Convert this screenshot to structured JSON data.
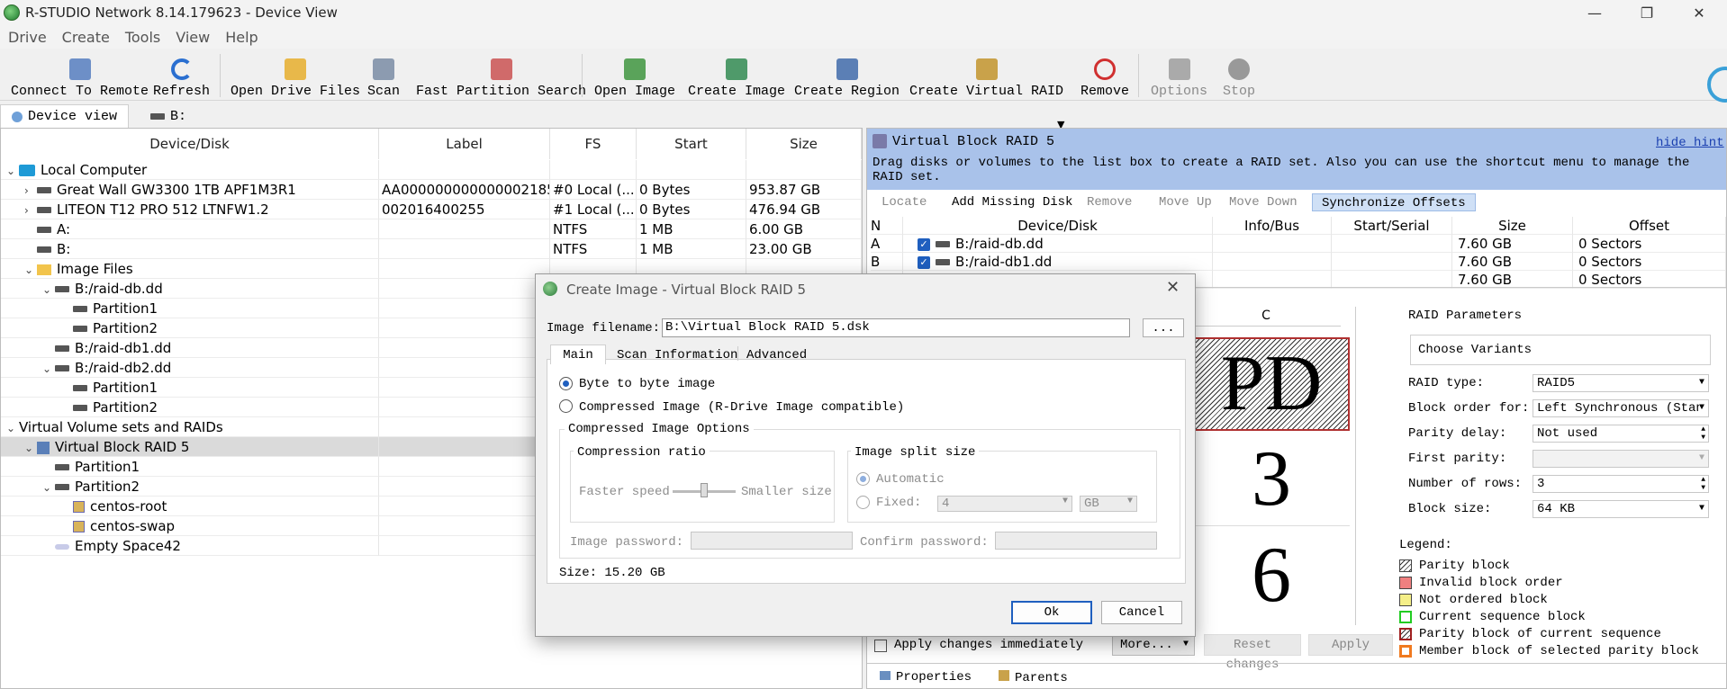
{
  "window": {
    "title": "R-STUDIO Network 8.14.179623 - Device View"
  },
  "menu": [
    "Drive",
    "Create",
    "Tools",
    "View",
    "Help"
  ],
  "toolbar": {
    "connect": "Connect To Remote",
    "refresh": "Refresh",
    "open_drive": "Open Drive Files",
    "scan": "Scan",
    "fast_search": "Fast Partition Search",
    "open_image": "Open Image",
    "create_image": "Create Image",
    "create_region": "Create Region",
    "create_vraid": "Create Virtual RAID",
    "remove": "Remove",
    "options": "Options",
    "stop": "Stop"
  },
  "tabs": {
    "device_view": "Device view",
    "b": "B:"
  },
  "tree": {
    "headers": {
      "device": "Device/Disk",
      "label": "Label",
      "fs": "FS",
      "start": "Start",
      "size": "Size"
    },
    "rows": [
      {
        "name": "Local Computer",
        "label": "",
        "fs": "",
        "start": "",
        "size": ""
      },
      {
        "name": "Great Wall GW3300 1TB APF1M3R1",
        "label": "AA000000000000002185",
        "fs": "#0 Local (...",
        "start": "0 Bytes",
        "size": "953.87 GB"
      },
      {
        "name": "LITEON T12 PRO 512 LTNFW1.2",
        "label": "002016400255",
        "fs": "#1 Local (...",
        "start": "0 Bytes",
        "size": "476.94 GB"
      },
      {
        "name": "A:",
        "label": "",
        "fs": "NTFS",
        "start": "1 MB",
        "size": "6.00 GB"
      },
      {
        "name": "B:",
        "label": "",
        "fs": "NTFS",
        "start": "1 MB",
        "size": "23.00 GB"
      },
      {
        "name": "Image Files",
        "label": "",
        "fs": "",
        "start": "",
        "size": ""
      },
      {
        "name": "B:/raid-db.dd",
        "label": "",
        "fs": "",
        "start": "",
        "size": ""
      },
      {
        "name": "Partition1",
        "label": "",
        "fs": "",
        "start": "",
        "size": ""
      },
      {
        "name": "Partition2",
        "label": "",
        "fs": "",
        "start": "",
        "size": ""
      },
      {
        "name": "B:/raid-db1.dd",
        "label": "",
        "fs": "",
        "start": "",
        "size": ""
      },
      {
        "name": "B:/raid-db2.dd",
        "label": "",
        "fs": "",
        "start": "",
        "size": ""
      },
      {
        "name": "Partition1",
        "label": "",
        "fs": "",
        "start": "",
        "size": ""
      },
      {
        "name": "Partition2",
        "label": "",
        "fs": "",
        "start": "",
        "size": ""
      },
      {
        "name": "Virtual Volume sets and RAIDs",
        "label": "",
        "fs": "",
        "start": "",
        "size": ""
      },
      {
        "name": "Virtual Block RAID 5",
        "label": "",
        "fs": "",
        "start": "",
        "size": ""
      },
      {
        "name": "Partition1",
        "label": "",
        "fs": "",
        "start": "",
        "size": ""
      },
      {
        "name": "Partition2",
        "label": "",
        "fs": "",
        "start": "",
        "size": ""
      },
      {
        "name": "centos-root",
        "label": "",
        "fs": "",
        "start": "",
        "size": ""
      },
      {
        "name": "centos-swap",
        "label": "",
        "fs": "",
        "start": "",
        "size": ""
      },
      {
        "name": "Empty Space42",
        "label": "",
        "fs": "",
        "start": "",
        "size": ""
      }
    ]
  },
  "raid": {
    "title": "Virtual Block RAID 5",
    "hide_hint": "hide hint",
    "hint": "Drag disks or volumes to the list box to create a RAID set. Also you can use the shortcut menu to manage the RAID set.",
    "tools": {
      "locate": "Locate",
      "add_missing": "Add Missing Disk",
      "remove": "Remove",
      "move_up": "Move Up",
      "move_down": "Move Down",
      "sync": "Synchronize Offsets"
    },
    "headers": {
      "n": "N",
      "device": "Device/Disk",
      "info": "Info/Bus",
      "start": "Start/Serial",
      "size": "Size",
      "offset": "Offset"
    },
    "disks": [
      {
        "n": "A",
        "device": "B:/raid-db.dd",
        "size": "7.60 GB",
        "offset": "0 Sectors"
      },
      {
        "n": "B",
        "device": "B:/raid-db1.dd",
        "size": "7.60 GB",
        "offset": "0 Sectors"
      },
      {
        "n": "",
        "device": "",
        "size": "7.60 GB",
        "offset": "0 Sectors"
      }
    ],
    "grid": {
      "col": "C",
      "cells": [
        "PD",
        "3",
        "6"
      ]
    },
    "params": {
      "title": "RAID Parameters",
      "choose": "Choose Variants",
      "type_label": "RAID type:",
      "type": "RAID5",
      "order_label": "Block order for:",
      "order": "Left Synchronous (Stan",
      "delay_label": "Parity delay:",
      "delay": "Not used",
      "first_label": "First parity:",
      "first": "",
      "rows_label": "Number of rows:",
      "rows": "3",
      "bsize_label": "Block size:",
      "bsize": "64 KB"
    },
    "legend_title": "Legend:",
    "legend": [
      "Parity block",
      "Invalid block order",
      "Not ordered block",
      "Current sequence block",
      "Parity block of current sequence",
      "Member block of selected parity block"
    ],
    "apply_immediately": "Apply changes immediately",
    "more": "More...",
    "reset": "Reset changes",
    "apply": "Apply",
    "bottom_tabs": {
      "properties": "Properties",
      "parents": "Parents"
    }
  },
  "dialog": {
    "title": "Create Image - Virtual Block RAID 5",
    "filename_label": "Image filename:",
    "filename": "B:\\Virtual Block RAID 5.dsk",
    "browse": "...",
    "tabs": {
      "main": "Main",
      "scan": "Scan Information",
      "advanced": "Advanced"
    },
    "byte": "Byte to byte image",
    "compressed": "Compressed Image (R-Drive Image compatible)",
    "opts_title": "Compressed Image Options",
    "ratio_title": "Compression ratio",
    "faster": "Faster speed",
    "smaller": "Smaller size",
    "split_title": "Image split size",
    "automatic": "Automatic",
    "fixed": "Fixed:",
    "fixed_val": "4",
    "unit": "GB",
    "pwd": "Image password:",
    "confirm": "Confirm password:",
    "size": "Size: 15.20 GB",
    "ok": "Ok",
    "cancel": "Cancel"
  }
}
